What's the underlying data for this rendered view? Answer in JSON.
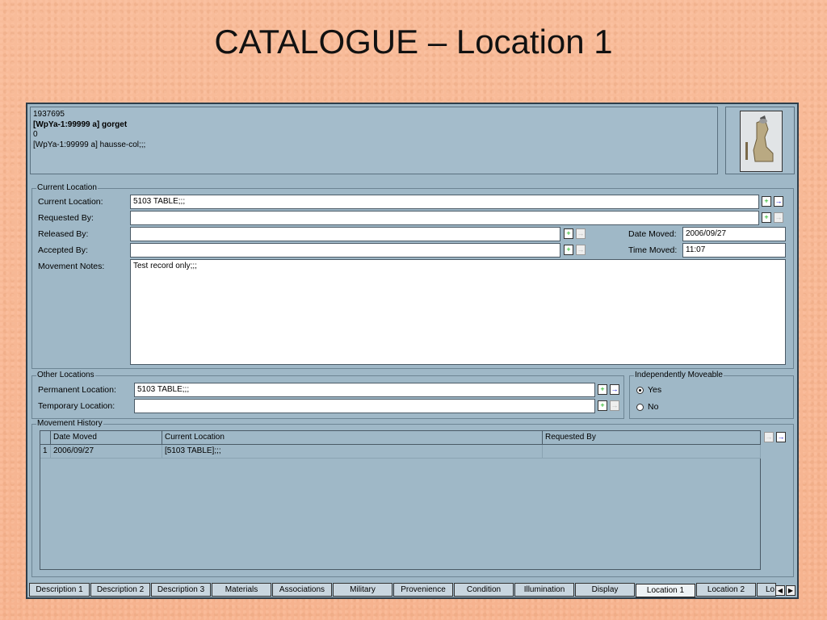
{
  "slide_title": "CATALOGUE – Location 1",
  "record": {
    "line1": "1937695",
    "line2": "[WpYa-1:99999 a] gorget",
    "line3": "0",
    "line4": "[WpYa-1:99999 a] hausse-col;;;"
  },
  "current_location_group": {
    "legend": "Current Location",
    "current_location_label": "Current Location:",
    "current_location_value": "5103 TABLE;;;",
    "requested_by_label": "Requested By:",
    "requested_by_value": "",
    "released_by_label": "Released By:",
    "released_by_value": "",
    "accepted_by_label": "Accepted By:",
    "accepted_by_value": "",
    "date_moved_label": "Date Moved:",
    "date_moved_value": "2006/09/27",
    "time_moved_label": "Time Moved:",
    "time_moved_value": "11:07",
    "movement_notes_label": "Movement Notes:",
    "movement_notes_value": "Test record only;;;"
  },
  "other_locations_group": {
    "legend": "Other Locations",
    "permanent_label": "Permanent Location:",
    "permanent_value": "5103 TABLE;;;",
    "temporary_label": "Temporary Location:",
    "temporary_value": ""
  },
  "moveable_group": {
    "legend": "Independently Moveable",
    "yes": "Yes",
    "no": "No",
    "selected": "Yes"
  },
  "movement_history": {
    "legend": "Movement History",
    "columns": [
      "Date Moved",
      "Current Location",
      "Requested By"
    ],
    "rows": [
      {
        "num": "1",
        "date": "2006/09/27",
        "location": "[5103 TABLE];;;",
        "requested_by": ""
      }
    ]
  },
  "tabs": [
    "Description 1",
    "Description 2",
    "Description 3",
    "Materials",
    "Associations",
    "Military",
    "Provenience",
    "Condition",
    "Illumination",
    "Display",
    "Location 1",
    "Location 2",
    "Lo"
  ],
  "active_tab": "Location 1"
}
